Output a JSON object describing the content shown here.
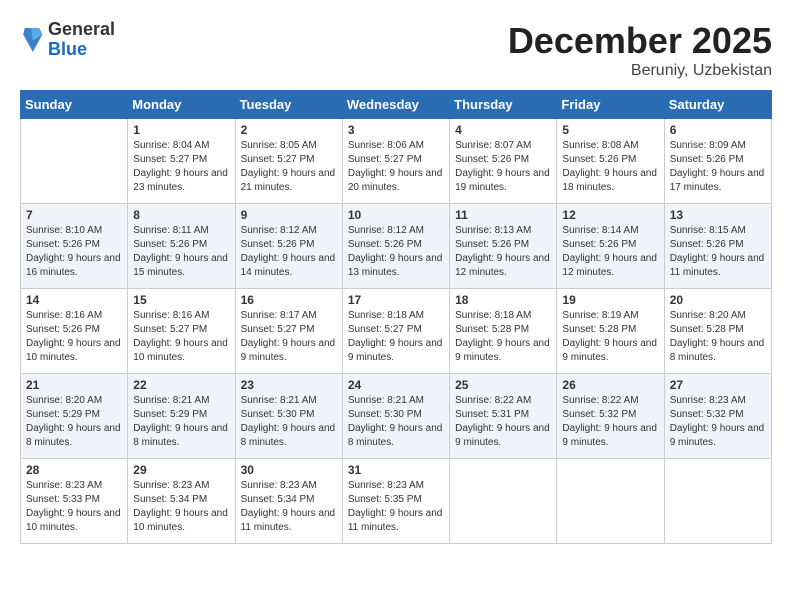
{
  "logo": {
    "general": "General",
    "blue": "Blue"
  },
  "header": {
    "month": "December 2025",
    "location": "Beruniy, Uzbekistan"
  },
  "weekdays": [
    "Sunday",
    "Monday",
    "Tuesday",
    "Wednesday",
    "Thursday",
    "Friday",
    "Saturday"
  ],
  "weeks": [
    [
      {
        "day": "",
        "content": ""
      },
      {
        "day": "1",
        "content": "Sunrise: 8:04 AM\nSunset: 5:27 PM\nDaylight: 9 hours\nand 23 minutes."
      },
      {
        "day": "2",
        "content": "Sunrise: 8:05 AM\nSunset: 5:27 PM\nDaylight: 9 hours\nand 21 minutes."
      },
      {
        "day": "3",
        "content": "Sunrise: 8:06 AM\nSunset: 5:27 PM\nDaylight: 9 hours\nand 20 minutes."
      },
      {
        "day": "4",
        "content": "Sunrise: 8:07 AM\nSunset: 5:26 PM\nDaylight: 9 hours\nand 19 minutes."
      },
      {
        "day": "5",
        "content": "Sunrise: 8:08 AM\nSunset: 5:26 PM\nDaylight: 9 hours\nand 18 minutes."
      },
      {
        "day": "6",
        "content": "Sunrise: 8:09 AM\nSunset: 5:26 PM\nDaylight: 9 hours\nand 17 minutes."
      }
    ],
    [
      {
        "day": "7",
        "content": "Sunrise: 8:10 AM\nSunset: 5:26 PM\nDaylight: 9 hours\nand 16 minutes."
      },
      {
        "day": "8",
        "content": "Sunrise: 8:11 AM\nSunset: 5:26 PM\nDaylight: 9 hours\nand 15 minutes."
      },
      {
        "day": "9",
        "content": "Sunrise: 8:12 AM\nSunset: 5:26 PM\nDaylight: 9 hours\nand 14 minutes."
      },
      {
        "day": "10",
        "content": "Sunrise: 8:12 AM\nSunset: 5:26 PM\nDaylight: 9 hours\nand 13 minutes."
      },
      {
        "day": "11",
        "content": "Sunrise: 8:13 AM\nSunset: 5:26 PM\nDaylight: 9 hours\nand 12 minutes."
      },
      {
        "day": "12",
        "content": "Sunrise: 8:14 AM\nSunset: 5:26 PM\nDaylight: 9 hours\nand 12 minutes."
      },
      {
        "day": "13",
        "content": "Sunrise: 8:15 AM\nSunset: 5:26 PM\nDaylight: 9 hours\nand 11 minutes."
      }
    ],
    [
      {
        "day": "14",
        "content": "Sunrise: 8:16 AM\nSunset: 5:26 PM\nDaylight: 9 hours\nand 10 minutes."
      },
      {
        "day": "15",
        "content": "Sunrise: 8:16 AM\nSunset: 5:27 PM\nDaylight: 9 hours\nand 10 minutes."
      },
      {
        "day": "16",
        "content": "Sunrise: 8:17 AM\nSunset: 5:27 PM\nDaylight: 9 hours\nand 9 minutes."
      },
      {
        "day": "17",
        "content": "Sunrise: 8:18 AM\nSunset: 5:27 PM\nDaylight: 9 hours\nand 9 minutes."
      },
      {
        "day": "18",
        "content": "Sunrise: 8:18 AM\nSunset: 5:28 PM\nDaylight: 9 hours\nand 9 minutes."
      },
      {
        "day": "19",
        "content": "Sunrise: 8:19 AM\nSunset: 5:28 PM\nDaylight: 9 hours\nand 9 minutes."
      },
      {
        "day": "20",
        "content": "Sunrise: 8:20 AM\nSunset: 5:28 PM\nDaylight: 9 hours\nand 8 minutes."
      }
    ],
    [
      {
        "day": "21",
        "content": "Sunrise: 8:20 AM\nSunset: 5:29 PM\nDaylight: 9 hours\nand 8 minutes."
      },
      {
        "day": "22",
        "content": "Sunrise: 8:21 AM\nSunset: 5:29 PM\nDaylight: 9 hours\nand 8 minutes."
      },
      {
        "day": "23",
        "content": "Sunrise: 8:21 AM\nSunset: 5:30 PM\nDaylight: 9 hours\nand 8 minutes."
      },
      {
        "day": "24",
        "content": "Sunrise: 8:21 AM\nSunset: 5:30 PM\nDaylight: 9 hours\nand 8 minutes."
      },
      {
        "day": "25",
        "content": "Sunrise: 8:22 AM\nSunset: 5:31 PM\nDaylight: 9 hours\nand 9 minutes."
      },
      {
        "day": "26",
        "content": "Sunrise: 8:22 AM\nSunset: 5:32 PM\nDaylight: 9 hours\nand 9 minutes."
      },
      {
        "day": "27",
        "content": "Sunrise: 8:23 AM\nSunset: 5:32 PM\nDaylight: 9 hours\nand 9 minutes."
      }
    ],
    [
      {
        "day": "28",
        "content": "Sunrise: 8:23 AM\nSunset: 5:33 PM\nDaylight: 9 hours\nand 10 minutes."
      },
      {
        "day": "29",
        "content": "Sunrise: 8:23 AM\nSunset: 5:34 PM\nDaylight: 9 hours\nand 10 minutes."
      },
      {
        "day": "30",
        "content": "Sunrise: 8:23 AM\nSunset: 5:34 PM\nDaylight: 9 hours\nand 11 minutes."
      },
      {
        "day": "31",
        "content": "Sunrise: 8:23 AM\nSunset: 5:35 PM\nDaylight: 9 hours\nand 11 minutes."
      },
      {
        "day": "",
        "content": ""
      },
      {
        "day": "",
        "content": ""
      },
      {
        "day": "",
        "content": ""
      }
    ]
  ]
}
